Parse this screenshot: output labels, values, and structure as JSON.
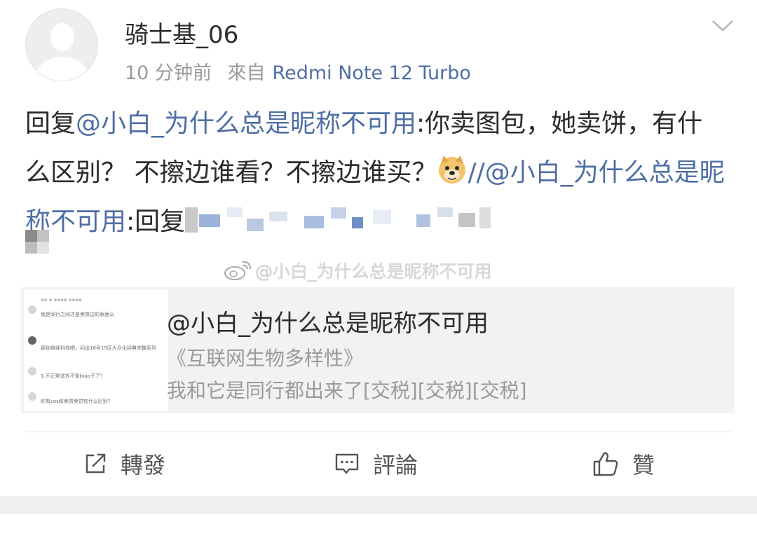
{
  "post": {
    "username": "骑士基_06",
    "time": "10 分钟前",
    "source_prefix": "來自",
    "device": "Redmi Note 12 Turbo",
    "reply_prefix": "回复",
    "mention_1": "@小白_为什么总是昵称不可用",
    "text_1": ":你卖图包，她卖饼，有什么区别？ 不擦边谁看？不擦边谁买？",
    "repost_sep": "//",
    "mention_2": "@小白_为什么总是昵称不可用",
    "text_2": ":回复"
  },
  "watermark": "@小白_为什么总是昵称不可用",
  "card": {
    "title": "@小白_为什么总是昵称不可用",
    "line1": "《互联网生物多样性》",
    "line2": "我和它是同行都出来了[交税][交税][交税]",
    "thumb_rows": [
      "就是同行之间才是卖擦边的表面么",
      "那你继续抖你吧，问出16号15区大众化经典完整系列",
      "1.不正常试衣不是blao子了？",
      "你有cos和卖肉卖饼有什么区别？"
    ]
  },
  "actions": {
    "repost": "轉發",
    "comment": "評論",
    "like": "贊"
  },
  "colors": {
    "link": "#4e6ea5",
    "text": "#2b2b2b",
    "muted": "#9a9a9a"
  },
  "icons": [
    "avatar-placeholder",
    "chevron-down-icon",
    "doge-emoji-icon",
    "weibo-logo-icon",
    "share-icon",
    "comment-icon",
    "thumbs-up-icon"
  ]
}
